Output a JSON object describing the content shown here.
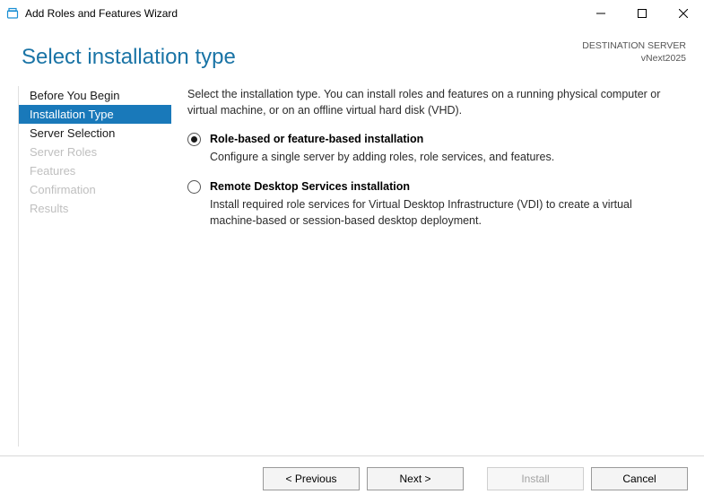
{
  "titlebar": {
    "title": "Add Roles and Features Wizard"
  },
  "header": {
    "page_title": "Select installation type",
    "destination_label": "DESTINATION SERVER",
    "destination_value": "vNext2025"
  },
  "nav": {
    "items": [
      {
        "label": "Before You Begin",
        "state": "normal"
      },
      {
        "label": "Installation Type",
        "state": "active"
      },
      {
        "label": "Server Selection",
        "state": "normal"
      },
      {
        "label": "Server Roles",
        "state": "disabled"
      },
      {
        "label": "Features",
        "state": "disabled"
      },
      {
        "label": "Confirmation",
        "state": "disabled"
      },
      {
        "label": "Results",
        "state": "disabled"
      }
    ]
  },
  "content": {
    "intro": "Select the installation type. You can install roles and features on a running physical computer or virtual machine, or on an offline virtual hard disk (VHD).",
    "options": [
      {
        "title": "Role-based or feature-based installation",
        "description": "Configure a single server by adding roles, role services, and features.",
        "selected": true
      },
      {
        "title": "Remote Desktop Services installation",
        "description": "Install required role services for Virtual Desktop Infrastructure (VDI) to create a virtual machine-based or session-based desktop deployment.",
        "selected": false
      }
    ]
  },
  "footer": {
    "previous": "< Previous",
    "next": "Next >",
    "install": "Install",
    "cancel": "Cancel"
  }
}
